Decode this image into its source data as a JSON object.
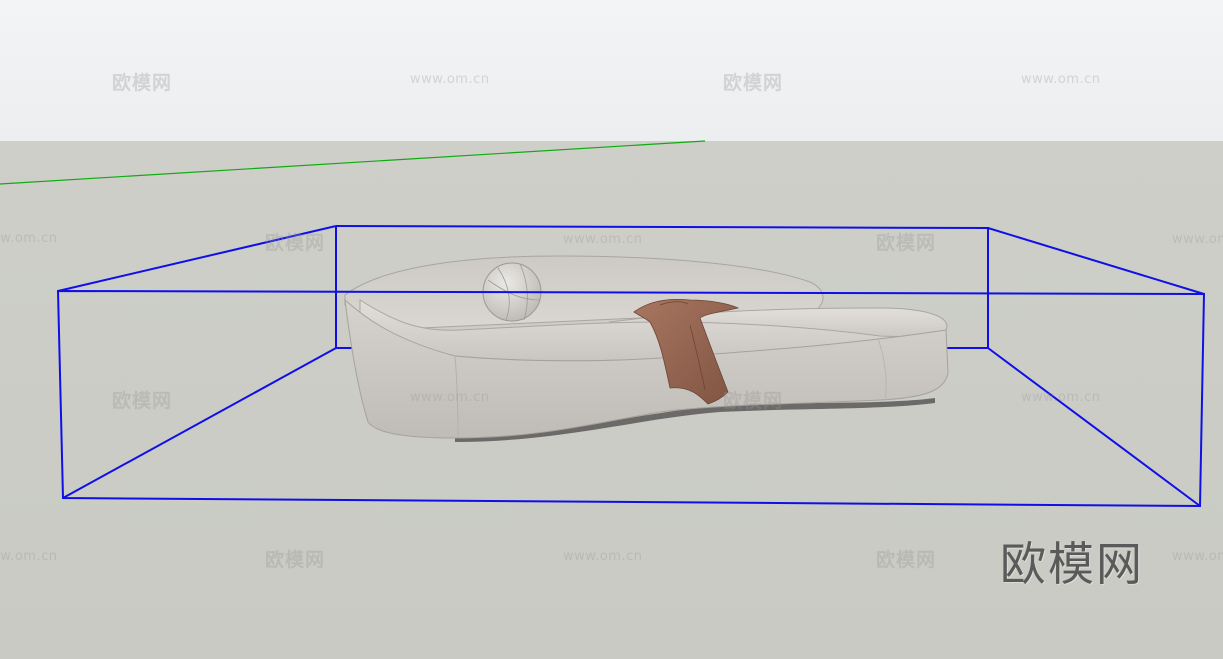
{
  "app": {
    "type": "3d-modeling-viewport"
  },
  "viewport": {
    "sky_color": "#eef0f1",
    "ground_color": "#cdcec8",
    "axis_color": "#11aa11",
    "bounding_box_color": "#1010e6"
  },
  "model": {
    "object": "curved sofa with round pillow and throw blanket",
    "sofa_color": "#d2cfca",
    "throw_color": "#9a6a56"
  },
  "watermarks": {
    "cn": "欧模网",
    "url": "www.om.cn"
  },
  "logo": {
    "text": "欧模网"
  }
}
